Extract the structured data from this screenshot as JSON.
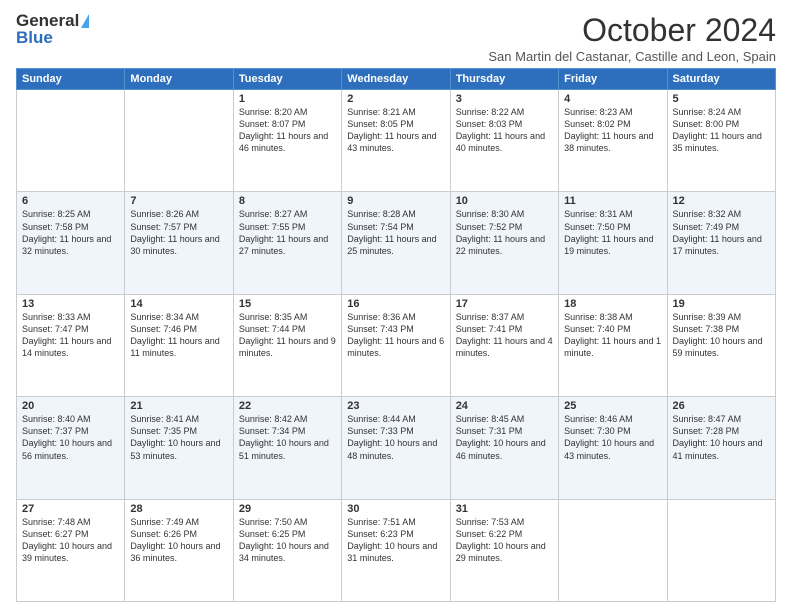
{
  "logo": {
    "general": "General",
    "blue": "Blue"
  },
  "title": {
    "month": "October 2024",
    "location": "San Martin del Castanar, Castille and Leon, Spain"
  },
  "weekdays": [
    "Sunday",
    "Monday",
    "Tuesday",
    "Wednesday",
    "Thursday",
    "Friday",
    "Saturday"
  ],
  "weeks": [
    [
      {
        "day": "",
        "sunrise": "",
        "sunset": "",
        "daylight": ""
      },
      {
        "day": "",
        "sunrise": "",
        "sunset": "",
        "daylight": ""
      },
      {
        "day": "1",
        "sunrise": "Sunrise: 8:20 AM",
        "sunset": "Sunset: 8:07 PM",
        "daylight": "Daylight: 11 hours and 46 minutes."
      },
      {
        "day": "2",
        "sunrise": "Sunrise: 8:21 AM",
        "sunset": "Sunset: 8:05 PM",
        "daylight": "Daylight: 11 hours and 43 minutes."
      },
      {
        "day": "3",
        "sunrise": "Sunrise: 8:22 AM",
        "sunset": "Sunset: 8:03 PM",
        "daylight": "Daylight: 11 hours and 40 minutes."
      },
      {
        "day": "4",
        "sunrise": "Sunrise: 8:23 AM",
        "sunset": "Sunset: 8:02 PM",
        "daylight": "Daylight: 11 hours and 38 minutes."
      },
      {
        "day": "5",
        "sunrise": "Sunrise: 8:24 AM",
        "sunset": "Sunset: 8:00 PM",
        "daylight": "Daylight: 11 hours and 35 minutes."
      }
    ],
    [
      {
        "day": "6",
        "sunrise": "Sunrise: 8:25 AM",
        "sunset": "Sunset: 7:58 PM",
        "daylight": "Daylight: 11 hours and 32 minutes."
      },
      {
        "day": "7",
        "sunrise": "Sunrise: 8:26 AM",
        "sunset": "Sunset: 7:57 PM",
        "daylight": "Daylight: 11 hours and 30 minutes."
      },
      {
        "day": "8",
        "sunrise": "Sunrise: 8:27 AM",
        "sunset": "Sunset: 7:55 PM",
        "daylight": "Daylight: 11 hours and 27 minutes."
      },
      {
        "day": "9",
        "sunrise": "Sunrise: 8:28 AM",
        "sunset": "Sunset: 7:54 PM",
        "daylight": "Daylight: 11 hours and 25 minutes."
      },
      {
        "day": "10",
        "sunrise": "Sunrise: 8:30 AM",
        "sunset": "Sunset: 7:52 PM",
        "daylight": "Daylight: 11 hours and 22 minutes."
      },
      {
        "day": "11",
        "sunrise": "Sunrise: 8:31 AM",
        "sunset": "Sunset: 7:50 PM",
        "daylight": "Daylight: 11 hours and 19 minutes."
      },
      {
        "day": "12",
        "sunrise": "Sunrise: 8:32 AM",
        "sunset": "Sunset: 7:49 PM",
        "daylight": "Daylight: 11 hours and 17 minutes."
      }
    ],
    [
      {
        "day": "13",
        "sunrise": "Sunrise: 8:33 AM",
        "sunset": "Sunset: 7:47 PM",
        "daylight": "Daylight: 11 hours and 14 minutes."
      },
      {
        "day": "14",
        "sunrise": "Sunrise: 8:34 AM",
        "sunset": "Sunset: 7:46 PM",
        "daylight": "Daylight: 11 hours and 11 minutes."
      },
      {
        "day": "15",
        "sunrise": "Sunrise: 8:35 AM",
        "sunset": "Sunset: 7:44 PM",
        "daylight": "Daylight: 11 hours and 9 minutes."
      },
      {
        "day": "16",
        "sunrise": "Sunrise: 8:36 AM",
        "sunset": "Sunset: 7:43 PM",
        "daylight": "Daylight: 11 hours and 6 minutes."
      },
      {
        "day": "17",
        "sunrise": "Sunrise: 8:37 AM",
        "sunset": "Sunset: 7:41 PM",
        "daylight": "Daylight: 11 hours and 4 minutes."
      },
      {
        "day": "18",
        "sunrise": "Sunrise: 8:38 AM",
        "sunset": "Sunset: 7:40 PM",
        "daylight": "Daylight: 11 hours and 1 minute."
      },
      {
        "day": "19",
        "sunrise": "Sunrise: 8:39 AM",
        "sunset": "Sunset: 7:38 PM",
        "daylight": "Daylight: 10 hours and 59 minutes."
      }
    ],
    [
      {
        "day": "20",
        "sunrise": "Sunrise: 8:40 AM",
        "sunset": "Sunset: 7:37 PM",
        "daylight": "Daylight: 10 hours and 56 minutes."
      },
      {
        "day": "21",
        "sunrise": "Sunrise: 8:41 AM",
        "sunset": "Sunset: 7:35 PM",
        "daylight": "Daylight: 10 hours and 53 minutes."
      },
      {
        "day": "22",
        "sunrise": "Sunrise: 8:42 AM",
        "sunset": "Sunset: 7:34 PM",
        "daylight": "Daylight: 10 hours and 51 minutes."
      },
      {
        "day": "23",
        "sunrise": "Sunrise: 8:44 AM",
        "sunset": "Sunset: 7:33 PM",
        "daylight": "Daylight: 10 hours and 48 minutes."
      },
      {
        "day": "24",
        "sunrise": "Sunrise: 8:45 AM",
        "sunset": "Sunset: 7:31 PM",
        "daylight": "Daylight: 10 hours and 46 minutes."
      },
      {
        "day": "25",
        "sunrise": "Sunrise: 8:46 AM",
        "sunset": "Sunset: 7:30 PM",
        "daylight": "Daylight: 10 hours and 43 minutes."
      },
      {
        "day": "26",
        "sunrise": "Sunrise: 8:47 AM",
        "sunset": "Sunset: 7:28 PM",
        "daylight": "Daylight: 10 hours and 41 minutes."
      }
    ],
    [
      {
        "day": "27",
        "sunrise": "Sunrise: 7:48 AM",
        "sunset": "Sunset: 6:27 PM",
        "daylight": "Daylight: 10 hours and 39 minutes."
      },
      {
        "day": "28",
        "sunrise": "Sunrise: 7:49 AM",
        "sunset": "Sunset: 6:26 PM",
        "daylight": "Daylight: 10 hours and 36 minutes."
      },
      {
        "day": "29",
        "sunrise": "Sunrise: 7:50 AM",
        "sunset": "Sunset: 6:25 PM",
        "daylight": "Daylight: 10 hours and 34 minutes."
      },
      {
        "day": "30",
        "sunrise": "Sunrise: 7:51 AM",
        "sunset": "Sunset: 6:23 PM",
        "daylight": "Daylight: 10 hours and 31 minutes."
      },
      {
        "day": "31",
        "sunrise": "Sunrise: 7:53 AM",
        "sunset": "Sunset: 6:22 PM",
        "daylight": "Daylight: 10 hours and 29 minutes."
      },
      {
        "day": "",
        "sunrise": "",
        "sunset": "",
        "daylight": ""
      },
      {
        "day": "",
        "sunrise": "",
        "sunset": "",
        "daylight": ""
      }
    ]
  ]
}
